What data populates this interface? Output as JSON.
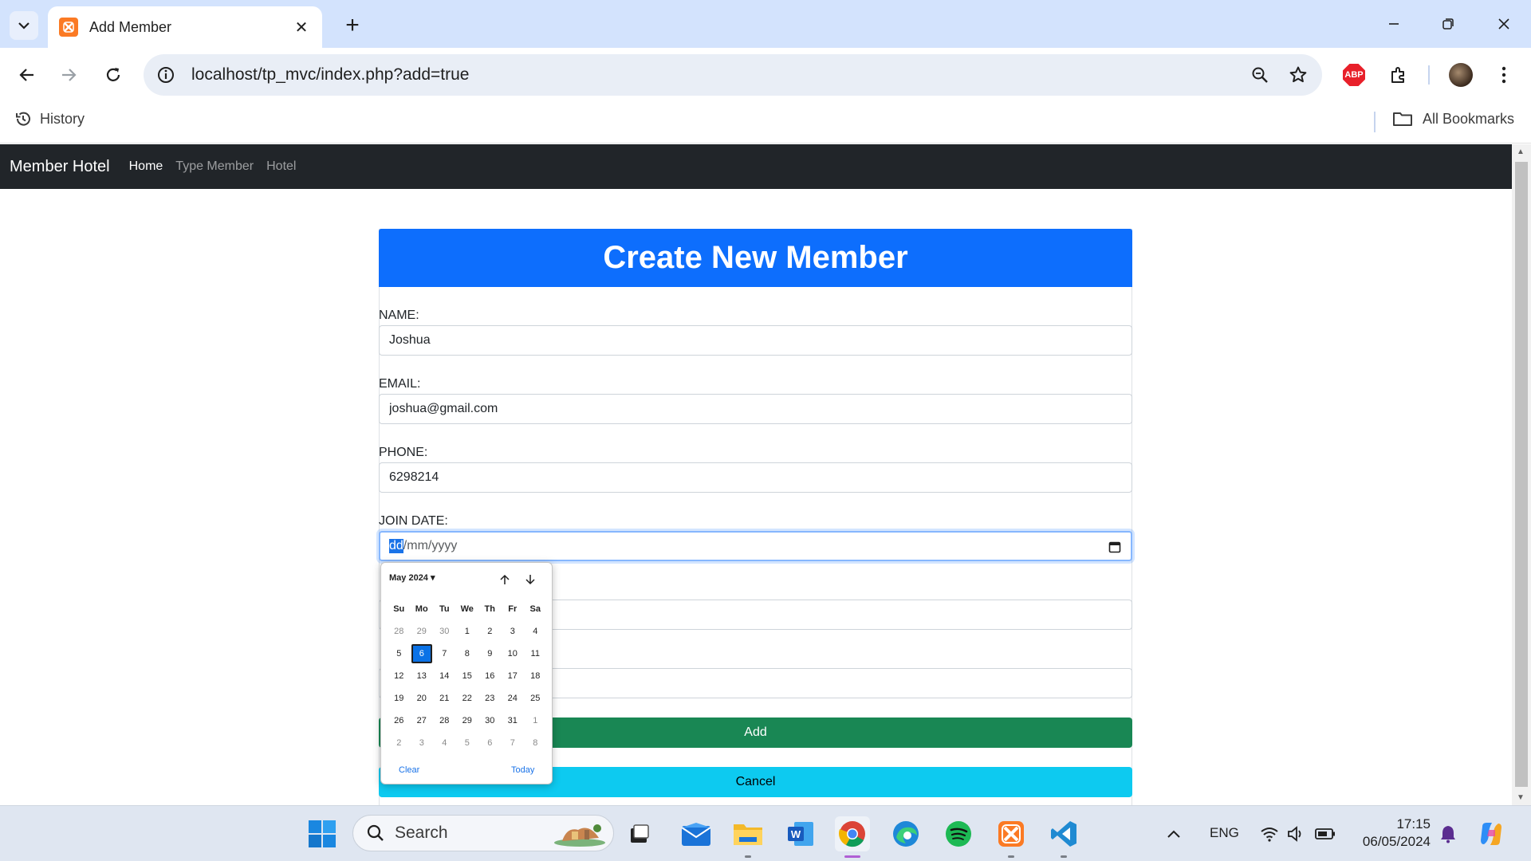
{
  "browser": {
    "tab_title": "Add Member",
    "url": "localhost/tp_mvc/index.php?add=true",
    "bookmark_history": "History",
    "bookmark_all": "All Bookmarks"
  },
  "nav": {
    "brand": "Member Hotel",
    "links": [
      "Home",
      "Type Member",
      "Hotel"
    ]
  },
  "form": {
    "heading": "Create New Member",
    "name_label": "NAME:",
    "name_value": "Joshua",
    "email_label": "EMAIL:",
    "email_value": "joshua@gmail.com",
    "phone_label": "PHONE:",
    "phone_value": "6298214",
    "date_label": "JOIN DATE:",
    "date_segment_active": "dd",
    "date_segment_rest": "/mm/yyyy",
    "add_button": "Add",
    "cancel_button": "Cancel"
  },
  "datepicker": {
    "month_label": "May 2024",
    "weekdays": [
      "Su",
      "Mo",
      "Tu",
      "We",
      "Th",
      "Fr",
      "Sa"
    ],
    "weeks": [
      [
        "28",
        "29",
        "30",
        "1",
        "2",
        "3",
        "4"
      ],
      [
        "5",
        "6",
        "7",
        "8",
        "9",
        "10",
        "11"
      ],
      [
        "12",
        "13",
        "14",
        "15",
        "16",
        "17",
        "18"
      ],
      [
        "19",
        "20",
        "21",
        "22",
        "23",
        "24",
        "25"
      ],
      [
        "26",
        "27",
        "28",
        "29",
        "30",
        "31",
        "1"
      ],
      [
        "2",
        "3",
        "4",
        "5",
        "6",
        "7",
        "8"
      ]
    ],
    "selected_day": "6",
    "clear_label": "Clear",
    "today_label": "Today"
  },
  "taskbar": {
    "search_label": "Search",
    "language": "ENG",
    "time": "17:15",
    "date": "06/05/2024"
  },
  "colors": {
    "navbar": "#212529",
    "header_primary": "#0d6efd",
    "add_button": "#198754",
    "cancel_button": "#0dcaf0",
    "tabstrip": "#d3e3fd"
  },
  "icons": [
    "tab-list-icon",
    "xampp-icon",
    "close-icon",
    "plus-icon",
    "minimize-icon",
    "restore-icon",
    "window-close-icon",
    "back-arrow-icon",
    "forward-arrow-icon",
    "reload-icon",
    "site-info-icon",
    "zoom-icon",
    "star-icon",
    "abp-icon",
    "extensions-icon",
    "profile-avatar",
    "kebab-menu-icon",
    "history-icon",
    "folder-icon",
    "calendar-icon",
    "arrow-up-icon",
    "arrow-down-icon",
    "windows-start-icon",
    "search-icon",
    "task-view-icon",
    "mail-icon",
    "file-explorer-icon",
    "word-icon",
    "chrome-icon",
    "edge-icon",
    "spotify-icon",
    "vscode-icon",
    "chevron-up-icon",
    "wifi-icon",
    "volume-icon",
    "battery-icon",
    "bell-icon",
    "copilot-icon"
  ]
}
